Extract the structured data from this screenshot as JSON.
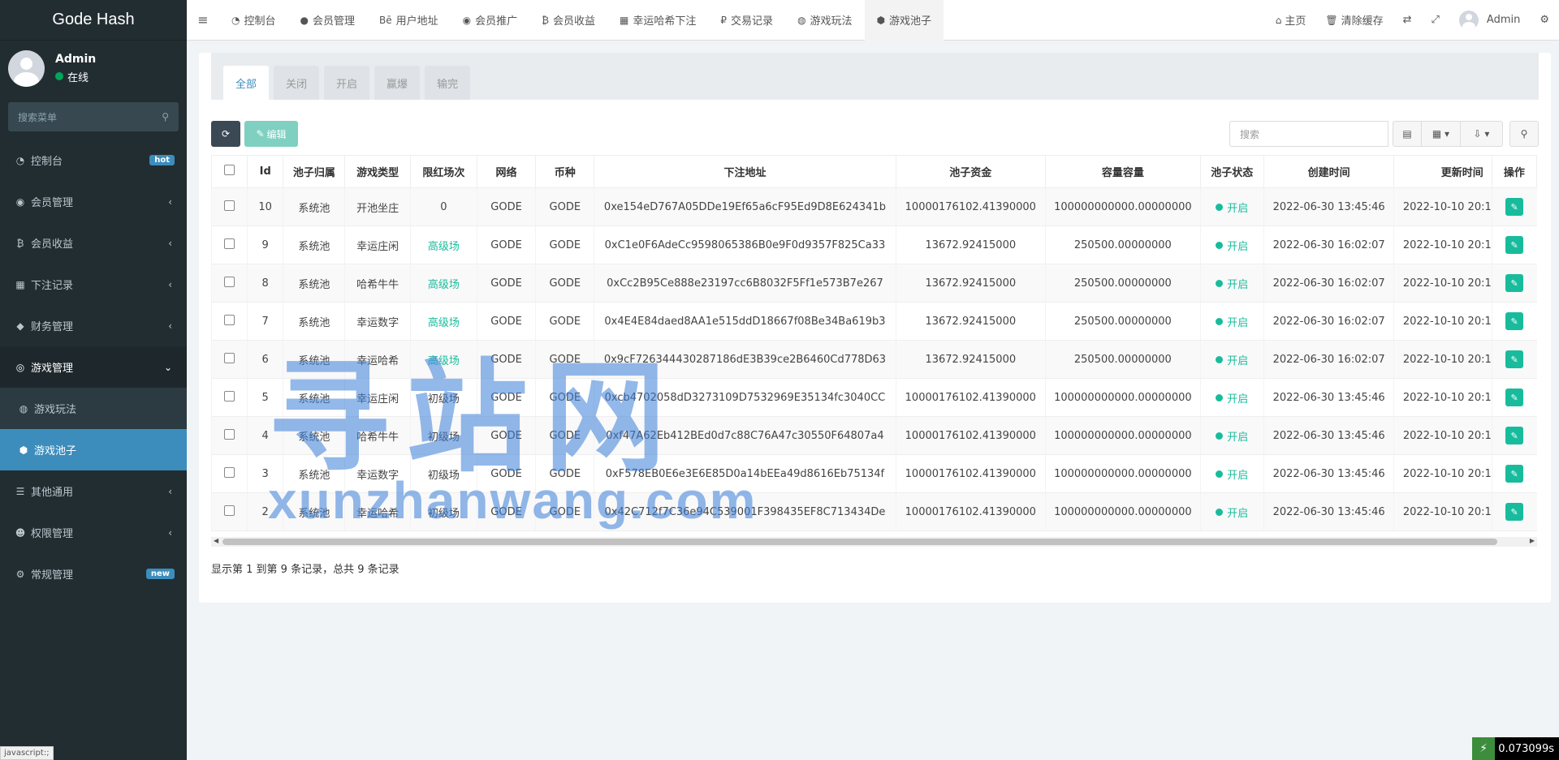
{
  "brand": {
    "title": "Gode Hash"
  },
  "user": {
    "name": "Admin",
    "status": "在线"
  },
  "sidebar": {
    "search_placeholder": "搜索菜单",
    "items": [
      {
        "label": "控制台",
        "icon": "dashboard-icon",
        "badge": "hot"
      },
      {
        "label": "会员管理",
        "icon": "user-circle-icon"
      },
      {
        "label": "会员收益",
        "icon": "bitcoin-icon"
      },
      {
        "label": "下注记录",
        "icon": "calendar-icon"
      },
      {
        "label": "财务管理",
        "icon": "diamond-icon"
      },
      {
        "label": "游戏管理",
        "icon": "gamepad-icon"
      },
      {
        "label": "游戏玩法",
        "icon": "dribbble-icon"
      },
      {
        "label": "游戏池子",
        "icon": "cube-icon"
      },
      {
        "label": "其他通用",
        "icon": "list-icon"
      },
      {
        "label": "权限管理",
        "icon": "users-icon"
      },
      {
        "label": "常规管理",
        "icon": "cogs-icon",
        "badge": "new"
      }
    ]
  },
  "topnav": {
    "tabs": [
      {
        "label": "控制台",
        "icon": "dashboard-icon"
      },
      {
        "label": "会员管理",
        "icon": "user-icon"
      },
      {
        "label": "用户地址",
        "icon": "behance-icon"
      },
      {
        "label": "会员推广",
        "icon": "eye-icon"
      },
      {
        "label": "会员收益",
        "icon": "bitcoin-icon"
      },
      {
        "label": "幸运哈希下注",
        "icon": "calendar-icon"
      },
      {
        "label": "交易记录",
        "icon": "ruble-icon"
      },
      {
        "label": "游戏玩法",
        "icon": "dribbble-icon"
      },
      {
        "label": "游戏池子",
        "icon": "cube-icon"
      }
    ],
    "home": "主页",
    "clear_cache": "清除缓存",
    "admin": "Admin"
  },
  "subtabs": [
    "全部",
    "关闭",
    "开启",
    "赢爆",
    "输完"
  ],
  "toolbar": {
    "edit": "编辑",
    "search_placeholder": "搜索"
  },
  "table": {
    "headers": [
      "Id",
      "池子归属",
      "游戏类型",
      "限红场次",
      "网络",
      "币种",
      "下注地址",
      "池子资金",
      "容量容量",
      "池子状态",
      "创建时间",
      "更新时间",
      "操作"
    ],
    "rows": [
      {
        "id": "10",
        "owner": "系统池",
        "type": "开池坐庄",
        "level": "0",
        "network": "GODE",
        "coin": "GODE",
        "address": "0xe154eD767A05DDe19Ef65a6cF95Ed9D8E624341b",
        "funds": "10000176102.41390000",
        "capacity": "100000000000.00000000",
        "status": "开启",
        "created": "2022-06-30 13:45:46",
        "updated": "2022-10-10 20:1"
      },
      {
        "id": "9",
        "owner": "系统池",
        "type": "幸运庄闲",
        "level": "高级场",
        "network": "GODE",
        "coin": "GODE",
        "address": "0xC1e0F6AdeCc9598065386B0e9F0d9357F825Ca33",
        "funds": "13672.92415000",
        "capacity": "250500.00000000",
        "status": "开启",
        "created": "2022-06-30 16:02:07",
        "updated": "2022-10-10 20:1"
      },
      {
        "id": "8",
        "owner": "系统池",
        "type": "哈希牛牛",
        "level": "高级场",
        "network": "GODE",
        "coin": "GODE",
        "address": "0xCc2B95Ce888e23197cc6B8032F5Ff1e573B7e267",
        "funds": "13672.92415000",
        "capacity": "250500.00000000",
        "status": "开启",
        "created": "2022-06-30 16:02:07",
        "updated": "2022-10-10 20:1"
      },
      {
        "id": "7",
        "owner": "系统池",
        "type": "幸运数字",
        "level": "高级场",
        "network": "GODE",
        "coin": "GODE",
        "address": "0x4E4E84daed8AA1e515ddD18667f08Be34Ba619b3",
        "funds": "13672.92415000",
        "capacity": "250500.00000000",
        "status": "开启",
        "created": "2022-06-30 16:02:07",
        "updated": "2022-10-10 20:1"
      },
      {
        "id": "6",
        "owner": "系统池",
        "type": "幸运哈希",
        "level": "高级场",
        "network": "GODE",
        "coin": "GODE",
        "address": "0x9cF726344430287186dE3B39ce2B6460Cd778D63",
        "funds": "13672.92415000",
        "capacity": "250500.00000000",
        "status": "开启",
        "created": "2022-06-30 16:02:07",
        "updated": "2022-10-10 20:1"
      },
      {
        "id": "5",
        "owner": "系统池",
        "type": "幸运庄闲",
        "level": "初级场",
        "network": "GODE",
        "coin": "GODE",
        "address": "0xcb4702058dD3273109D7532969E35134fc3040CC",
        "funds": "10000176102.41390000",
        "capacity": "100000000000.00000000",
        "status": "开启",
        "created": "2022-06-30 13:45:46",
        "updated": "2022-10-10 20:1"
      },
      {
        "id": "4",
        "owner": "系统池",
        "type": "哈希牛牛",
        "level": "初级场",
        "network": "GODE",
        "coin": "GODE",
        "address": "0xf47A62Eb412BEd0d7c88C76A47c30550F64807a4",
        "funds": "10000176102.41390000",
        "capacity": "100000000000.00000000",
        "status": "开启",
        "created": "2022-06-30 13:45:46",
        "updated": "2022-10-10 20:1"
      },
      {
        "id": "3",
        "owner": "系统池",
        "type": "幸运数字",
        "level": "初级场",
        "network": "GODE",
        "coin": "GODE",
        "address": "0xF578EB0E6e3E6E85D0a14bEEa49d8616Eb75134f",
        "funds": "10000176102.41390000",
        "capacity": "100000000000.00000000",
        "status": "开启",
        "created": "2022-06-30 13:45:46",
        "updated": "2022-10-10 20:1"
      },
      {
        "id": "2",
        "owner": "系统池",
        "type": "幸运哈希",
        "level": "初级场",
        "network": "GODE",
        "coin": "GODE",
        "address": "0x42C712f7C36e94C539001F398435EF8C713434De",
        "funds": "10000176102.41390000",
        "capacity": "100000000000.00000000",
        "status": "开启",
        "created": "2022-06-30 13:45:46",
        "updated": "2022-10-10 20:1"
      }
    ]
  },
  "summary": "显示第 1 到第 9 条记录，总共 9 条记录",
  "watermark": {
    "cn": "寻站网",
    "en": "xunzhanwang.com"
  },
  "statusbar": "javascript:;",
  "timer": "0.073099s",
  "colors": {
    "sidebar": "#222d32",
    "accent": "#3c8dbc",
    "success": "#18bc9c"
  }
}
